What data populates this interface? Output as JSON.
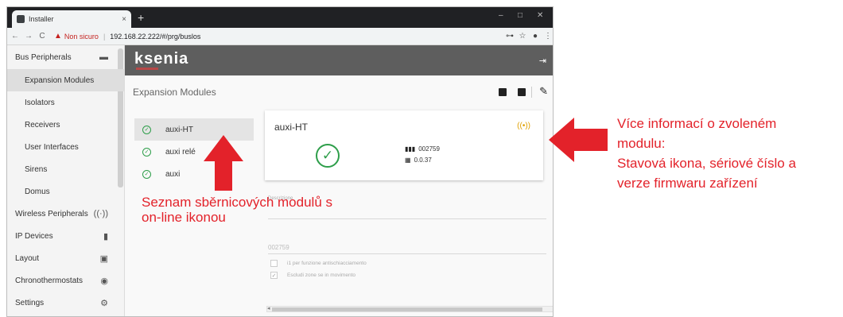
{
  "browser": {
    "tab_title": "Installer",
    "tab_close": "×",
    "new_tab": "+",
    "win_min": "–",
    "win_max": "□",
    "win_close": "✕",
    "back": "←",
    "forward": "→",
    "reload": "C",
    "not_secure": "Non sicuro",
    "url": "192.168.22.222/#/prg/buslos"
  },
  "sidebar": {
    "items": [
      {
        "label": "Bus Peripherals"
      },
      {
        "label": "Expansion Modules"
      },
      {
        "label": "Isolators"
      },
      {
        "label": "Receivers"
      },
      {
        "label": "User Interfaces"
      },
      {
        "label": "Sirens"
      },
      {
        "label": "Domus"
      },
      {
        "label": "Wireless Peripherals"
      },
      {
        "label": "IP Devices"
      },
      {
        "label": "Layout"
      },
      {
        "label": "Chronothermostats"
      },
      {
        "label": "Settings"
      }
    ]
  },
  "header": {
    "logo": "ksenia"
  },
  "content": {
    "title": "Expansion Modules",
    "modules": [
      {
        "label": "auxi-HT"
      },
      {
        "label": "auxi relé"
      },
      {
        "label": "auxi"
      }
    ],
    "card": {
      "title": "auxi-HT",
      "serial": "002759",
      "firmware": "0.0.37"
    },
    "form": {
      "description_label": "Descrizione",
      "serial_value": "002759",
      "check1_label": "i1 per funzione antischiacciamento",
      "check2_label": "Escludi zone se in movimento"
    }
  },
  "annotations": {
    "left": "Seznam sběrnicových modulů s on-line ikonou",
    "right_line1": "Více informací o zvoleném",
    "right_line2": "modulu:",
    "right_line3": "Stavová ikona, sériové číslo a",
    "right_line4": "verze firmwaru zařízení"
  },
  "colors": {
    "accent_red": "#e3222a",
    "status_green": "#2e9e4a",
    "header_gray": "#5e5e5e"
  }
}
